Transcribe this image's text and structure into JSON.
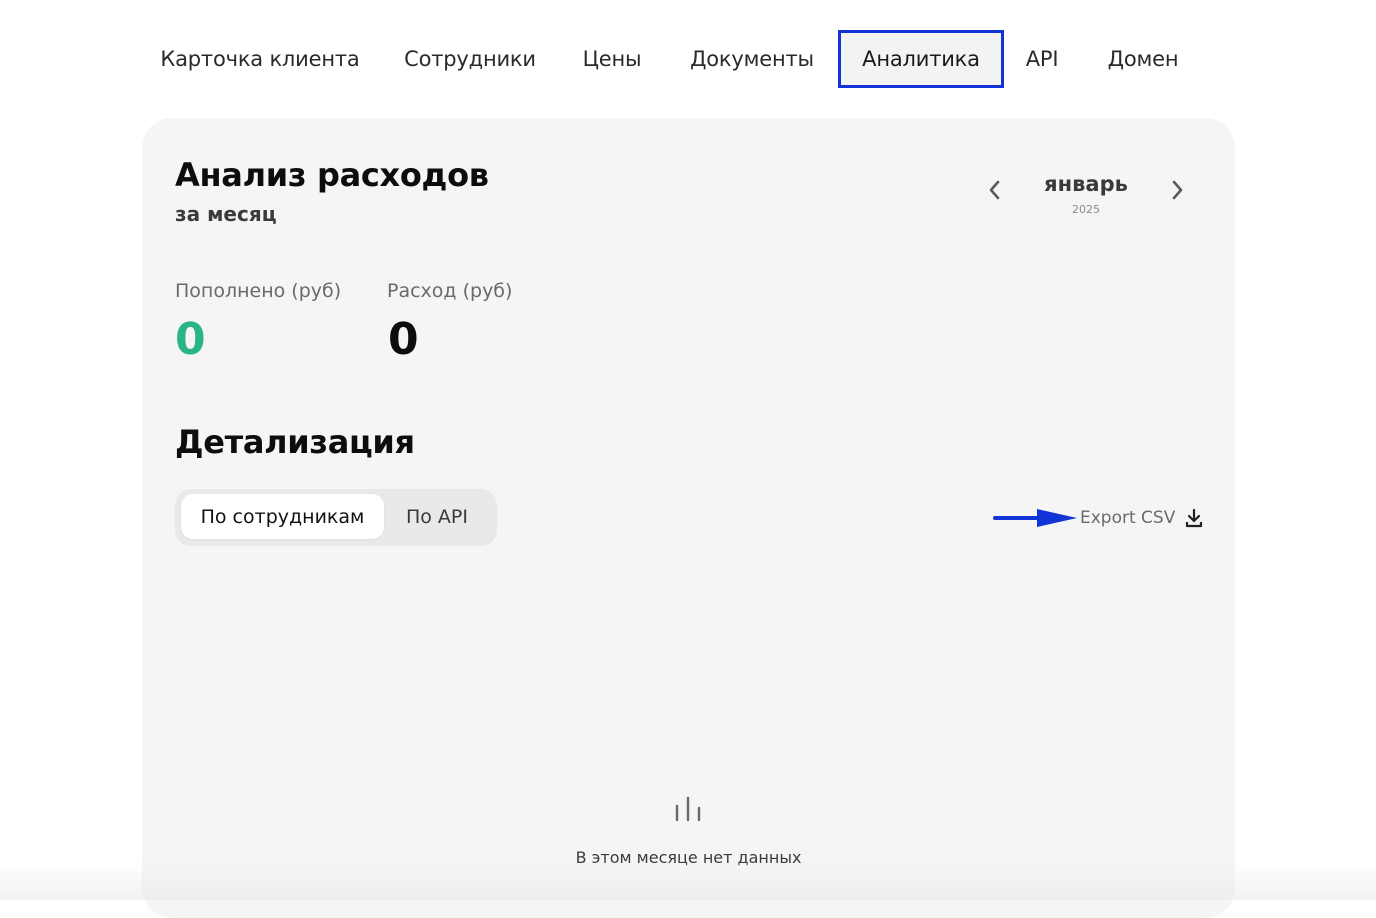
{
  "tabs": [
    {
      "label": "Карточка клиента"
    },
    {
      "label": "Сотрудники"
    },
    {
      "label": "Цены"
    },
    {
      "label": "Документы"
    },
    {
      "label": "Аналитика",
      "active": true
    },
    {
      "label": "API"
    },
    {
      "label": "Домен"
    }
  ],
  "analysis": {
    "title": "Анализ расходов",
    "subtitle": "за месяц",
    "month": "январь",
    "year": "2025",
    "prev_icon": "chevron-left-icon",
    "next_icon": "chevron-right-icon"
  },
  "stats": {
    "topped_up_label": "Пополнено (руб)",
    "topped_up_value": "0",
    "topped_up_color": "#2bb584",
    "expense_label": "Расход (руб)",
    "expense_value": "0",
    "expense_color": "#0d0d0d"
  },
  "details": {
    "title": "Детализация",
    "segments": [
      {
        "label": "По сотрудникам",
        "active": true
      },
      {
        "label": "По API",
        "active": false
      }
    ],
    "export_label": "Export CSV",
    "export_icon": "download-icon"
  },
  "empty_state": {
    "icon": "bar-chart-icon",
    "text": "В этом месяце нет данных"
  },
  "colors": {
    "active_tab_border": "#1233d6",
    "annotation_arrow": "#1233d6"
  }
}
